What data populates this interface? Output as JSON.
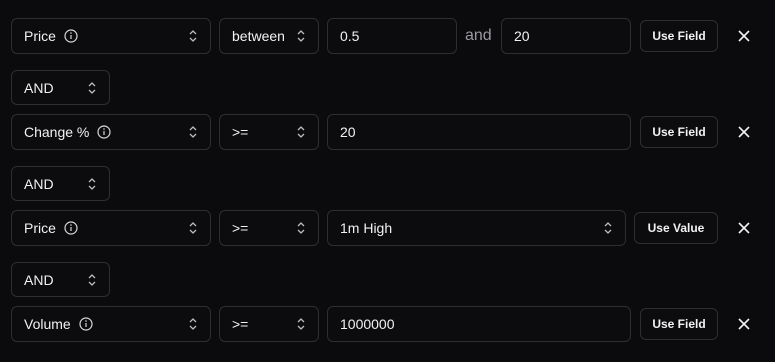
{
  "rows": [
    {
      "field": {
        "label": "Price",
        "icon": "info-icon"
      },
      "operator": "between",
      "value": "0.5",
      "connector": "and",
      "value2": "20",
      "action": "Use Field"
    },
    {
      "field": {
        "label": "Change %",
        "icon": "info-icon"
      },
      "operator": ">=",
      "value": "20",
      "action": "Use Field"
    },
    {
      "field": {
        "label": "Price",
        "icon": "info-icon"
      },
      "operator": ">=",
      "value": "1m High",
      "action": "Use Value"
    },
    {
      "field": {
        "label": "Volume",
        "icon": "info-icon"
      },
      "operator": ">=",
      "value": "1000000",
      "action": "Use Field"
    }
  ],
  "logic": [
    "AND",
    "AND",
    "AND"
  ],
  "icons": {
    "remove": "close-icon",
    "dropdown": "chevron-up-down-icon"
  },
  "colors": {
    "background": "#0b0b0d",
    "border": "#2d2d33",
    "text": "#f2f2f4",
    "muted": "#9a9aa2"
  }
}
